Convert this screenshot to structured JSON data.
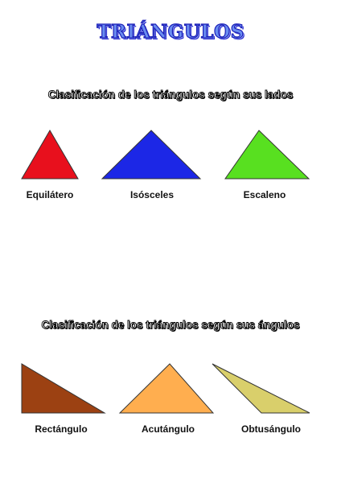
{
  "title": "TRIÁNGULOS",
  "sections": [
    {
      "heading": "Clasificación de los triángulos según sus lados",
      "shapes": [
        {
          "label": "Equilátero",
          "color": "#e8101d"
        },
        {
          "label": "Isósceles",
          "color": "#1c27e6"
        },
        {
          "label": "Escaleno",
          "color": "#58e020"
        }
      ]
    },
    {
      "heading": "Clasificación de los triángulos según sus ángulos",
      "shapes": [
        {
          "label": "Rectángulo",
          "color": "#9c4112"
        },
        {
          "label": "Acutángulo",
          "color": "#ffae4f"
        },
        {
          "label": "Obtusángulo",
          "color": "#d9cf6b"
        }
      ]
    }
  ]
}
